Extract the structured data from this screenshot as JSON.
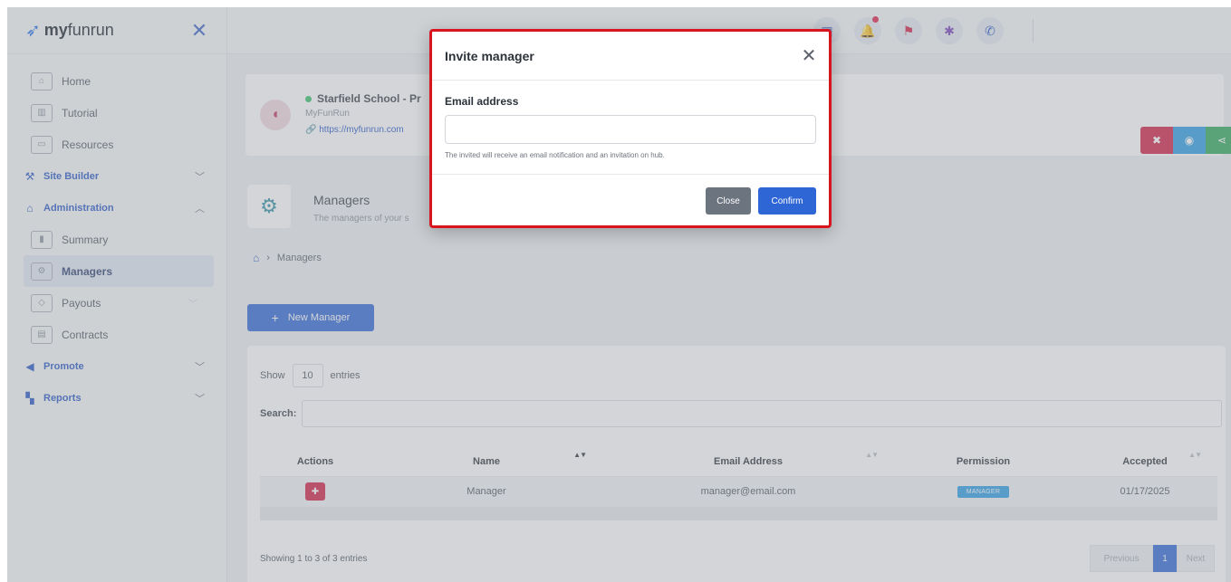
{
  "brand": {
    "logo_bold": "my",
    "logo_light": "funrun",
    "close_icon": "x-icon"
  },
  "sidebar": {
    "items": [
      {
        "label": "Home",
        "icon": "home-icon"
      },
      {
        "label": "Tutorial",
        "icon": "book-icon"
      },
      {
        "label": "Resources",
        "icon": "folder-icon"
      }
    ],
    "sections": {
      "site_builder": "Site Builder",
      "administration": "Administration",
      "promote": "Promote",
      "reports": "Reports"
    },
    "admin_items": [
      {
        "label": "Summary",
        "icon": "chart-icon"
      },
      {
        "label": "Managers",
        "icon": "users-gear-icon",
        "active": true
      },
      {
        "label": "Payouts",
        "icon": "wallet-icon"
      },
      {
        "label": "Contracts",
        "icon": "document-icon"
      }
    ]
  },
  "topbar": {
    "icons": [
      "grid-icon",
      "bell-icon",
      "flag-us-icon",
      "bug-icon",
      "phone-icon"
    ]
  },
  "school": {
    "name": "Starfield School - Pr",
    "org": "MyFunRun",
    "url": "https://myfunrun.com"
  },
  "page": {
    "title": "Managers",
    "subtitle": "The managers of your s",
    "breadcrumb": "Managers"
  },
  "new_manager_label": "New Manager",
  "table": {
    "show_label": "Show",
    "show_value": "10",
    "entries_label": "entries",
    "search_label": "Search:",
    "headers": [
      "Actions",
      "Name",
      "Email Address",
      "Permission",
      "Accepted"
    ],
    "rows": [
      {
        "name": "Manager",
        "email": "manager@email.com",
        "permission": "MANAGER",
        "accepted": "01/17/2025"
      }
    ],
    "info": "Showing 1 to 3 of 3 entries",
    "pager": {
      "previous": "Previous",
      "current": "1",
      "next": "Next"
    }
  },
  "modal": {
    "title": "Invite manager",
    "field_label": "Email address",
    "email_value": "",
    "help": "The invited will receive an email notification and an invitation on hub.",
    "close_label": "Close",
    "confirm_label": "Confirm"
  },
  "colors": {
    "accent": "#2f66d6",
    "danger": "#d01f44",
    "info": "#2b9ee6",
    "success": "#2fa859",
    "modal_highlight": "#d8141f"
  }
}
